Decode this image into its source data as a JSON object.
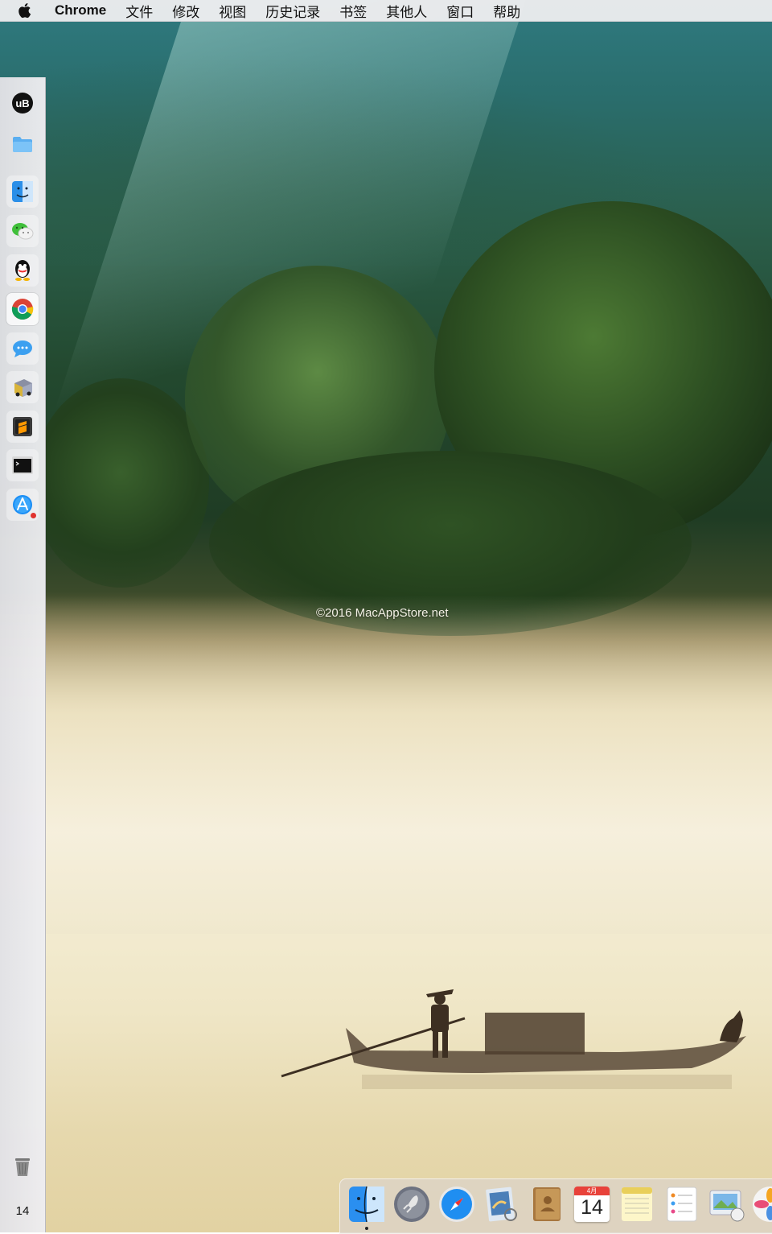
{
  "menubar": {
    "apple_icon": "apple-icon",
    "app_name": "Chrome",
    "items": [
      "文件",
      "修改",
      "视图",
      "历史记录",
      "书签",
      "其他人",
      "窗口",
      "帮助"
    ]
  },
  "wallpaper": {
    "watermark": "©2016 MacAppStore.net"
  },
  "side_dock": {
    "icons": [
      "ublock-icon",
      "folder-icon",
      "finder-icon",
      "wechat-icon",
      "qq-icon",
      "chrome-icon",
      "messages-icon",
      "transmit-icon",
      "sublime-text-icon",
      "terminal-icon",
      "app-store-icon"
    ],
    "trash_icon": "trash-icon",
    "date": "14",
    "ublock_label": "uB"
  },
  "bottom_dock": {
    "icons": [
      "finder-icon",
      "launchpad-icon",
      "safari-icon",
      "preview-icon",
      "contacts-icon",
      "calendar-icon",
      "notes-icon",
      "reminders-icon",
      "photo-booth-icon",
      "photos-icon"
    ],
    "calendar_month": "4月",
    "calendar_day": "14"
  },
  "colors": {
    "menubar": "#ececee",
    "dock": "#e2e2e6",
    "chrome_red": "#db4437",
    "chrome_yellow": "#f4c20d",
    "chrome_green": "#0f9d58",
    "chrome_blue": "#4285f4"
  }
}
